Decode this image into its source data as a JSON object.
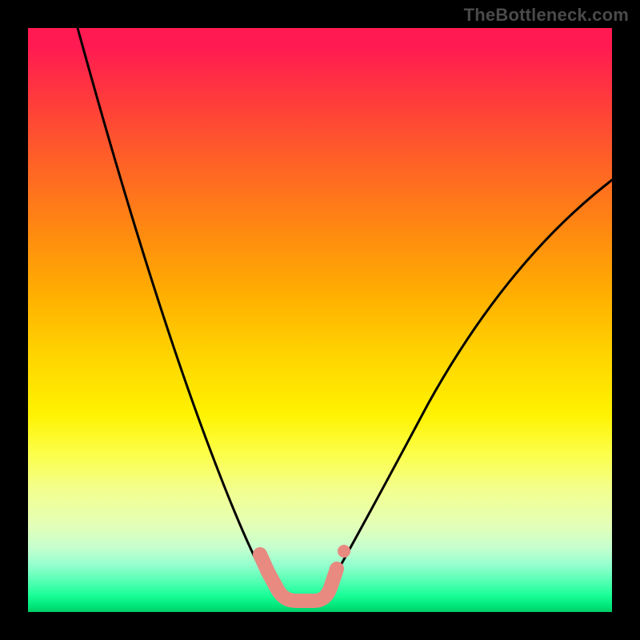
{
  "watermark": "TheBottleneck.com",
  "colors": {
    "frame": "#000000",
    "curve": "#000000",
    "highlight": "#e88a80",
    "gradient_top": "#ff1a52",
    "gradient_bottom": "#00cc66"
  },
  "chart_data": {
    "type": "line",
    "title": "",
    "xlabel": "",
    "ylabel": "",
    "xlim": [
      0,
      100
    ],
    "ylim": [
      0,
      100
    ],
    "grid": false,
    "legend": false,
    "annotations": [],
    "background_gradient_stops": [
      {
        "pos": 0,
        "color": "#ff1a52"
      },
      {
        "pos": 12,
        "color": "#ff3a3c"
      },
      {
        "pos": 24,
        "color": "#ff6525"
      },
      {
        "pos": 35,
        "color": "#ff8a10"
      },
      {
        "pos": 46,
        "color": "#ffb000"
      },
      {
        "pos": 56,
        "color": "#ffd400"
      },
      {
        "pos": 66,
        "color": "#fff200"
      },
      {
        "pos": 79,
        "color": "#f3ff8e"
      },
      {
        "pos": 89,
        "color": "#c6ffcf"
      },
      {
        "pos": 95,
        "color": "#4effb0"
      },
      {
        "pos": 100,
        "color": "#00cc66"
      }
    ],
    "series": [
      {
        "name": "left-branch",
        "color": "#000000",
        "x": [
          8,
          15,
          22,
          28,
          33,
          38,
          41,
          43
        ],
        "y": [
          100,
          72,
          48,
          30,
          17,
          8,
          4,
          3
        ]
      },
      {
        "name": "right-branch",
        "color": "#000000",
        "x": [
          51,
          55,
          60,
          68,
          78,
          90,
          100
        ],
        "y": [
          4,
          10,
          20,
          36,
          52,
          66,
          74
        ]
      },
      {
        "name": "valley-highlight",
        "color": "#e88a80",
        "x": [
          40,
          41,
          43,
          46,
          49,
          51,
          53
        ],
        "y": [
          10,
          7,
          3,
          2,
          2,
          4,
          7
        ]
      }
    ],
    "markers": [
      {
        "name": "dot",
        "x": 54,
        "y": 10,
        "color": "#e88a80"
      }
    ]
  }
}
